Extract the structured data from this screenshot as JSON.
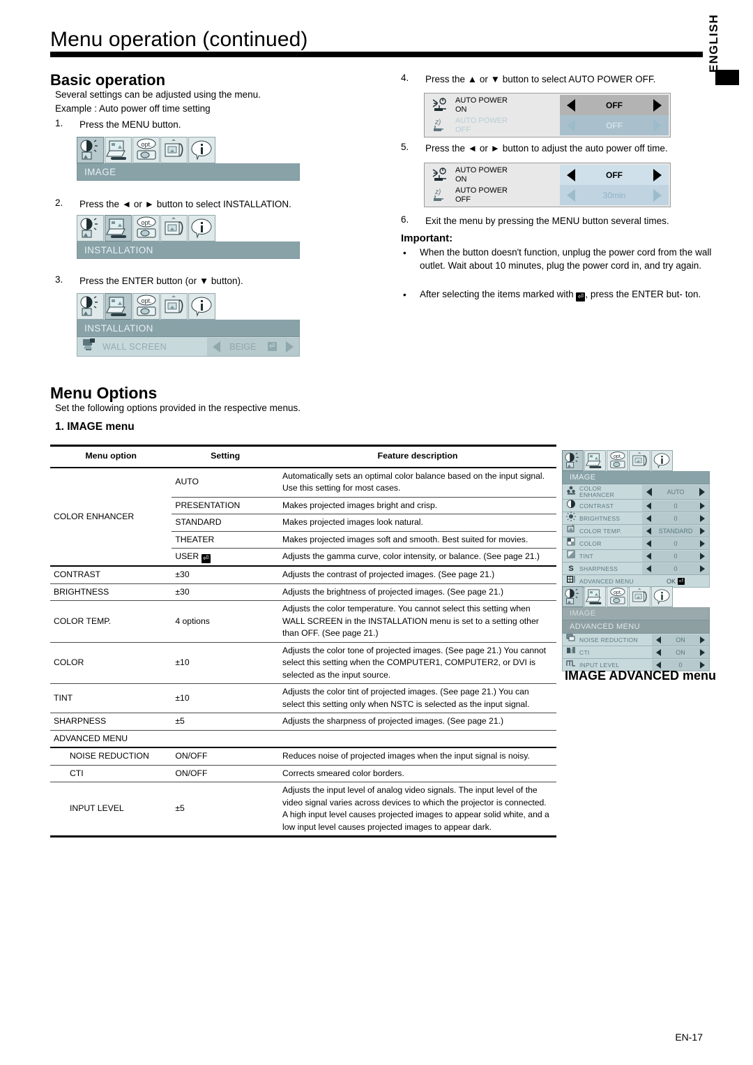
{
  "page": {
    "title": "Menu operation (continued)",
    "language_tab": "ENGLISH",
    "page_number": "EN-17"
  },
  "basic_operation": {
    "heading": "Basic operation",
    "intro": "Several settings can be adjusted using the menu.",
    "example": "Example : Auto power off time setting",
    "steps": [
      {
        "num": "1.",
        "text": "Press the MENU button."
      },
      {
        "num": "2.",
        "text": "Press the ◄ or ► button to select INSTALLATION."
      },
      {
        "num": "3.",
        "text": "Press the ENTER button (or ▼ button)."
      },
      {
        "num": "4.",
        "text": "Press the ▲ or ▼ button to select AUTO POWER OFF."
      },
      {
        "num": "5.",
        "text": "Press the ◄ or ► button to adjust the auto power off time."
      },
      {
        "num": "6.",
        "text": "Exit the menu by pressing the MENU button several times."
      }
    ]
  },
  "osd_step1": {
    "bar": "IMAGE",
    "selected_tab": 0
  },
  "osd_step2": {
    "bar": "INSTALLATION",
    "selected_tab": 1
  },
  "osd_step3": {
    "bar": "INSTALLATION",
    "selected_tab": 1,
    "row": {
      "icon": "wall-screen-icon",
      "label": "WALL SCREEN",
      "value": "BEIGE"
    }
  },
  "auto_power_step4": {
    "rows": [
      {
        "icon": "auto-power-on-icon",
        "label_line1": "AUTO POWER",
        "label_line2": "ON",
        "value": "OFF",
        "state": "active"
      },
      {
        "icon": "auto-power-off-icon",
        "label_line1": "AUTO POWER",
        "label_line2": "OFF",
        "value": "OFF",
        "state": "dim"
      }
    ]
  },
  "auto_power_step5": {
    "rows": [
      {
        "icon": "auto-power-on-icon",
        "label_line1": "AUTO POWER",
        "label_line2": "ON",
        "value": "OFF",
        "state": "blue"
      },
      {
        "icon": "auto-power-off-icon",
        "label_line1": "AUTO POWER",
        "label_line2": "OFF",
        "value": "30min",
        "state": "dimblue"
      }
    ]
  },
  "important": {
    "heading": "Important:",
    "bullets": [
      "When the button doesn't function, unplug the power cord from the wall outlet. Wait about 10 minutes, plug the power cord in, and try again.",
      "After selecting the items marked with ⏎ , press the ENTER button."
    ],
    "bullet2_pre": "After selecting the items marked with",
    "bullet2_post": ", press the ENTER but-",
    "bullet2_tail": "ton."
  },
  "menu_options": {
    "heading": "Menu Options",
    "intro": "Set the following options provided in the respective menus.",
    "section_title": "1. IMAGE menu"
  },
  "image_table": {
    "headers": [
      "Menu option",
      "Setting",
      "Feature description"
    ],
    "rows": [
      {
        "option": "COLOR ENHANCER",
        "option_rowspan": 5,
        "setting": "AUTO",
        "setting_enter": false,
        "desc": "Automatically sets an optimal color balance based on the input signal. Use this setting for most cases."
      },
      {
        "option": "",
        "setting": "PRESENTATION",
        "setting_enter": false,
        "desc": "Makes projected images bright and crisp."
      },
      {
        "option": "",
        "setting": "STANDARD",
        "setting_enter": false,
        "desc": "Makes projected images look natural."
      },
      {
        "option": "",
        "setting": "THEATER",
        "setting_enter": false,
        "desc": "Makes projected images soft and smooth. Best suited for movies."
      },
      {
        "option": "",
        "setting": "USER",
        "setting_enter": true,
        "desc": "Adjusts the gamma curve, color intensity, or balance. (See page 21.)"
      },
      {
        "option": "CONTRAST",
        "setting": "±30",
        "setting_enter": false,
        "desc": "Adjusts the contrast of projected images. (See page 21.)"
      },
      {
        "option": "BRIGHTNESS",
        "setting": "±30",
        "setting_enter": false,
        "desc": "Adjusts the brightness of projected images. (See page 21.)"
      },
      {
        "option": "COLOR TEMP.",
        "setting": "4 options",
        "setting_enter": false,
        "desc": "Adjusts the color temperature. You cannot select this setting when WALL SCREEN in the INSTALLATION menu is set to a setting other than OFF. (See page 21.)"
      },
      {
        "option": "COLOR",
        "setting": "±10",
        "setting_enter": false,
        "desc": "Adjusts the color tone of projected images. (See page 21.)  You cannot select this setting when the COMPUTER1, COMPUTER2, or DVI is selected as the input source."
      },
      {
        "option": "TINT",
        "setting": "±10",
        "setting_enter": false,
        "desc": "Adjusts the color tint of projected images.  (See page 21.) You can select this setting only when NSTC is selected as the input signal."
      },
      {
        "option": "SHARPNESS",
        "setting": "±5",
        "setting_enter": false,
        "desc": "Adjusts the sharpness of projected images. (See page 21.)"
      }
    ],
    "advanced_label": "ADVANCED MENU",
    "advanced_rows": [
      {
        "option": "NOISE REDUCTION",
        "setting": "ON/OFF",
        "desc": "Reduces noise of projected images when the input signal is noisy."
      },
      {
        "option": "CTI",
        "setting": "ON/OFF",
        "desc": "Corrects smeared color borders."
      },
      {
        "option": "INPUT LEVEL",
        "setting": "±5",
        "desc": "Adjusts the input level of analog video signals. The input level of the video signal varies across devices to which the projector is connected. A high input level causes projected images to appear solid white, and a low input level causes projected images to appear dark."
      }
    ]
  },
  "image_menu_panel": {
    "bar": "IMAGE",
    "selected_tab": 0,
    "rows": [
      {
        "icon": "color-enhancer-icon",
        "label": "COLOR\nENHANCER",
        "label1": "COLOR",
        "label2": "ENHANCER",
        "value": "AUTO",
        "type": "arrows"
      },
      {
        "icon": "contrast-icon",
        "label": "CONTRAST",
        "value": "0",
        "type": "arrows"
      },
      {
        "icon": "brightness-icon",
        "label": "BRIGHTNESS",
        "value": "0",
        "type": "arrows"
      },
      {
        "icon": "color-temp-icon",
        "label": "COLOR TEMP.",
        "value": "STANDARD",
        "type": "arrows"
      },
      {
        "icon": "color-icon",
        "label": "COLOR",
        "value": "0",
        "type": "arrows"
      },
      {
        "icon": "tint-icon",
        "label": "TINT",
        "value": "0",
        "type": "arrows"
      },
      {
        "icon": "sharpness-icon",
        "label": "SHARPNESS",
        "value": "0",
        "type": "arrows"
      },
      {
        "icon": "advanced-menu-icon",
        "label": "ADVANCED MENU",
        "value": "OK",
        "type": "ok"
      }
    ]
  },
  "image_advanced_panel": {
    "bar1": "IMAGE",
    "bar2": "ADVANCED MENU",
    "selected_tab": 0,
    "caption": "IMAGE ADVANCED menu",
    "rows": [
      {
        "icon": "noise-reduction-icon",
        "label": "NOISE REDUCTION",
        "value": "ON"
      },
      {
        "icon": "cti-icon",
        "label": "CTI",
        "value": "ON"
      },
      {
        "icon": "input-level-icon",
        "label": "INPUT LEVEL",
        "value": "0"
      }
    ]
  }
}
